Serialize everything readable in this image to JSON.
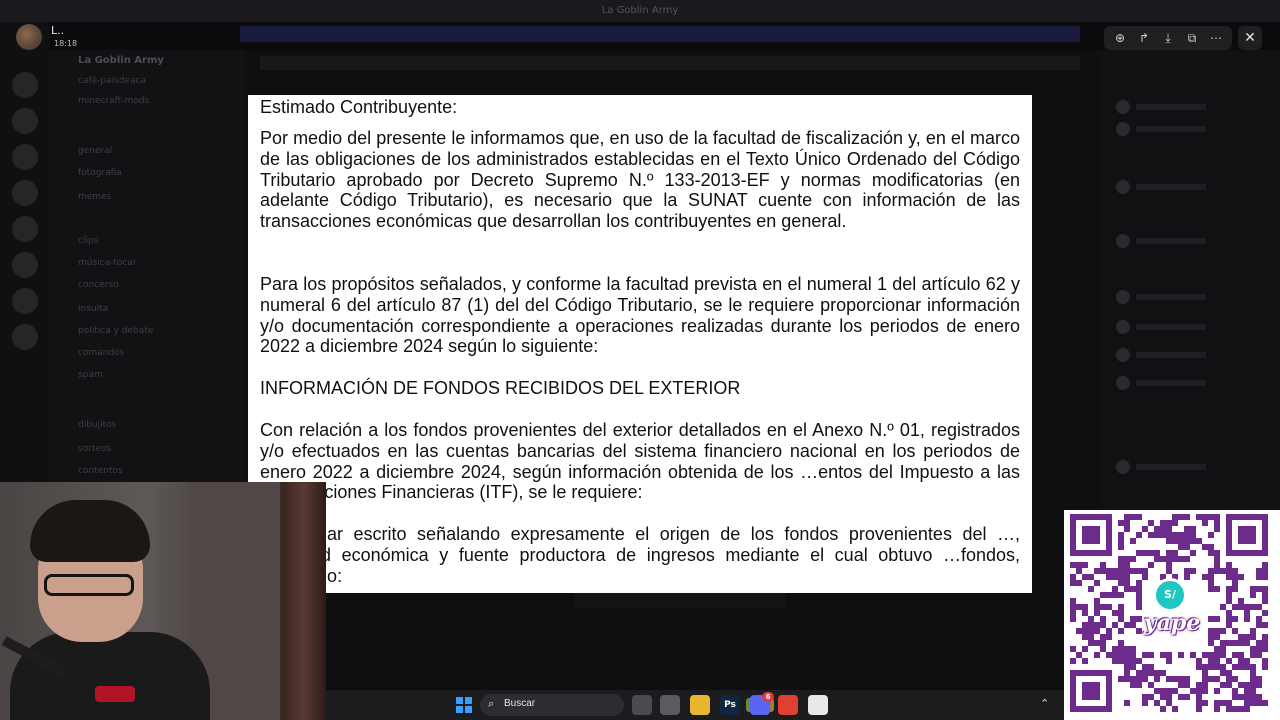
{
  "app": {
    "window_title": "La Goblin Army"
  },
  "viewer": {
    "user_name": "L..",
    "timestamp": "18:18",
    "toolbar": [
      "zoom-in-icon",
      "forward-icon",
      "download-icon",
      "open-external-icon",
      "more-icon"
    ],
    "close_label": "✕"
  },
  "background": {
    "server_name": "La Goblin Army",
    "channels": [
      "café-paisdeaca",
      "minecraft-mods",
      "general",
      "memes",
      "fotografía",
      "clips",
      "música-tocar",
      "concerso",
      "insulta",
      "política y debate",
      "comandos",
      "spam",
      "dibujitos",
      "sorteos",
      "contentos"
    ],
    "main_top": "memes"
  },
  "document": {
    "greeting": "Estimado Contribuyente:",
    "para1": "Por medio del presente le informamos que, en uso de la facultad de fiscalización y, en el marco de las obligaciones de los administrados establecidas en el Texto Único Ordenado del Código Tributario aprobado por Decreto Supremo N.º 133-2013-EF y normas modificatorias (en adelante Código Tributario), es necesario que la SUNAT cuente con información de las transacciones económicas que desarrollan los contribuyentes en general.",
    "para2": "Para los propósitos señalados, y conforme la facultad prevista en el numeral 1 del artículo 62 y numeral 6 del artículo 87 (1) del del Código Tributario, se le requiere proporcionar información y/o documentación correspondiente a operaciones realizadas durante los periodos de enero 2022 a diciembre 2024 según lo siguiente:",
    "heading": "INFORMACIÓN DE FONDOS RECIBIDOS DEL EXTERIOR",
    "para3": "Con relación a los fondos provenientes del exterior detallados en el Anexo N.º 01, registrados y/o efectuados en las cuentas bancarias del sistema financiero nacional en los periodos de enero 2022 a diciembre 2024, según información obtenida de los …entos del Impuesto a las Transacciones Financieras (ITF), se le requiere:",
    "para4": "…orcionar escrito señalando expresamente el origen de los fondos provenientes del …, actividad económica y fuente productora de ingresos mediante el cual obtuvo …fondos, indicando:"
  },
  "taskbar": {
    "search_placeholder": "Buscar",
    "apps": [
      {
        "name": "task-view",
        "label": "",
        "color": "#4a4a52"
      },
      {
        "name": "app-printer",
        "label": "",
        "color": "#5a5a63"
      },
      {
        "name": "file-explorer",
        "label": "",
        "color": "#e8b631"
      },
      {
        "name": "photoshop",
        "label": "Ps",
        "color": "#0f2640"
      },
      {
        "name": "discord",
        "label": "",
        "color": "#5865f2",
        "badge": "6"
      },
      {
        "name": "chrome",
        "label": "",
        "color": "#de4032"
      },
      {
        "name": "app-red",
        "label": "",
        "color": "#e8e8e8"
      }
    ]
  },
  "qr": {
    "brand": "yape",
    "badge_text": "S/"
  },
  "colors": {
    "yape_purple": "#6d2c8b",
    "discord_blurple": "#5865f2",
    "document_bg": "#ffffff"
  }
}
